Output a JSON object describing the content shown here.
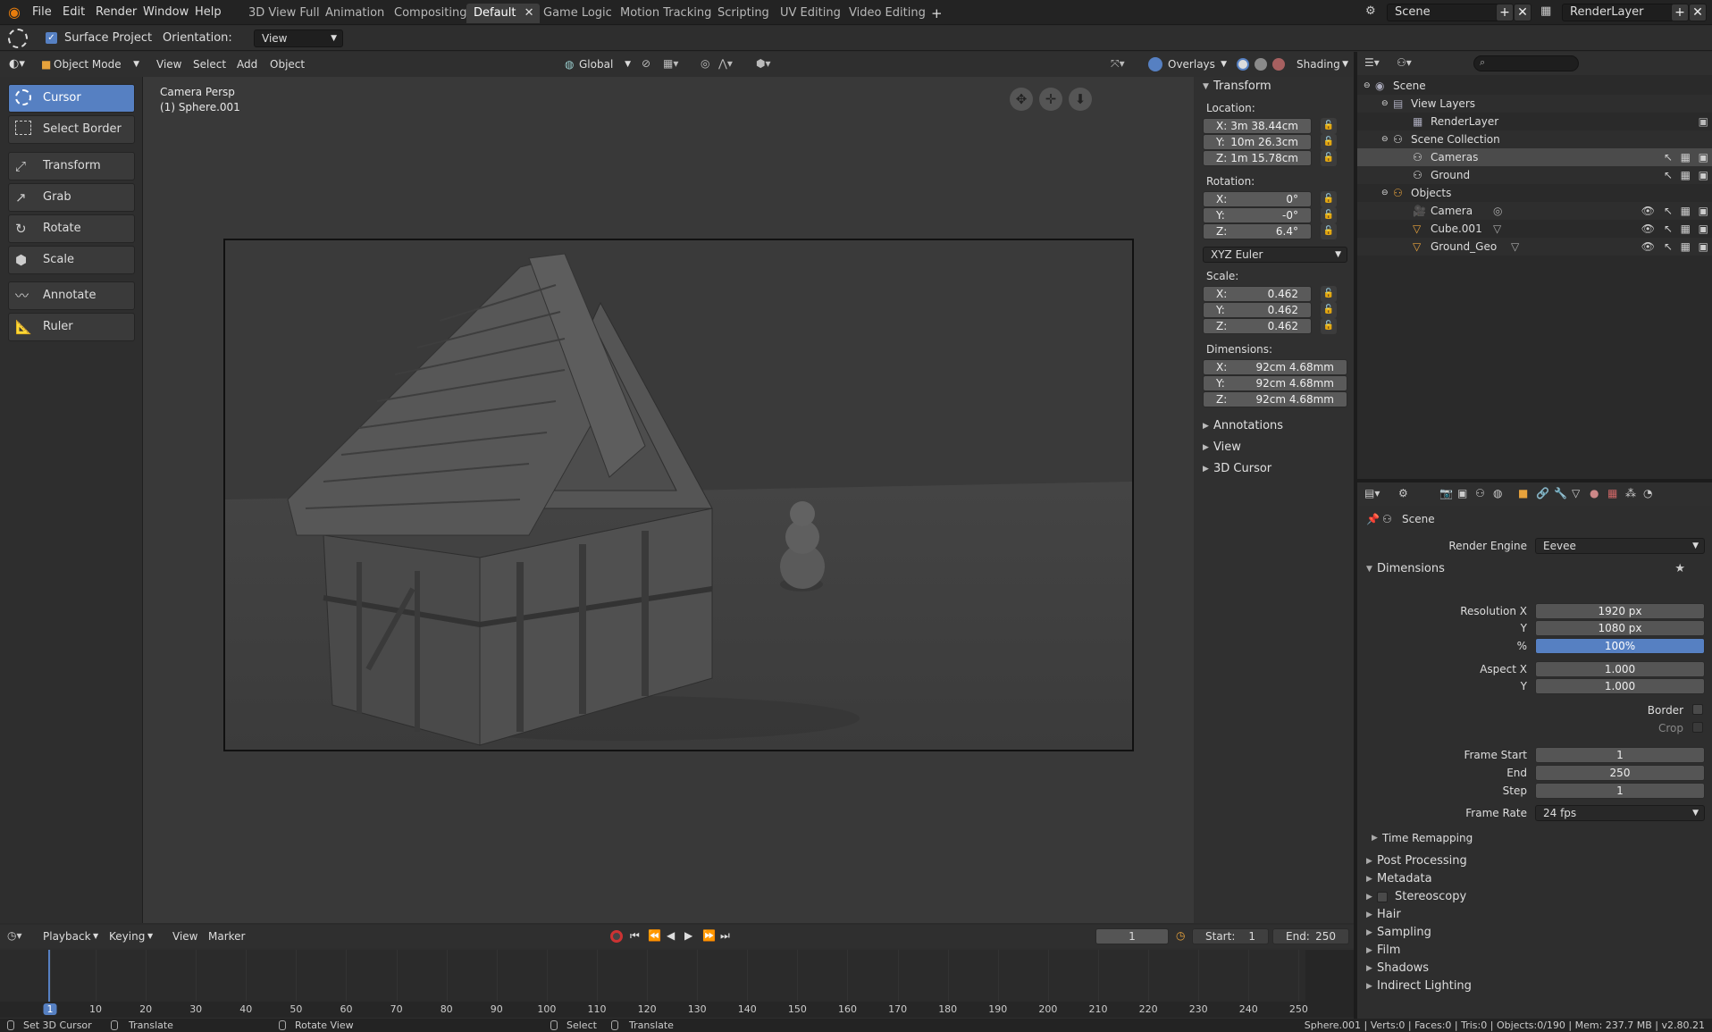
{
  "menu": [
    "File",
    "Edit",
    "Render",
    "Window",
    "Help"
  ],
  "workspaces": [
    {
      "label": "3D View Full",
      "active": false
    },
    {
      "label": "Animation",
      "active": false
    },
    {
      "label": "Compositing",
      "active": false
    },
    {
      "label": "Default",
      "active": true
    },
    {
      "label": "Game Logic",
      "active": false
    },
    {
      "label": "Motion Tracking",
      "active": false
    },
    {
      "label": "Scripting",
      "active": false
    },
    {
      "label": "UV Editing",
      "active": false
    },
    {
      "label": "Video Editing",
      "active": false
    }
  ],
  "scene_field": "Scene",
  "renderlayer_field": "RenderLayer",
  "tool_settings": {
    "surface_project": "Surface Project",
    "orientation_label": "Orientation:",
    "orientation_value": "View"
  },
  "view_header": {
    "mode": "Object Mode",
    "menus": [
      "View",
      "Select",
      "Add",
      "Object"
    ],
    "transform_orientation": "Global",
    "overlays": "Overlays",
    "shading": "Shading"
  },
  "viewport_info": {
    "line1": "Camera Persp",
    "line2": "(1) Sphere.001"
  },
  "tools": [
    {
      "label": "Cursor",
      "active": true,
      "icon": "cursor-icon"
    },
    {
      "label": "Select Border",
      "active": false,
      "icon": "select-border-icon"
    },
    {
      "label": "Transform",
      "active": false,
      "icon": "transform-icon"
    },
    {
      "label": "Grab",
      "active": false,
      "icon": "grab-icon"
    },
    {
      "label": "Rotate",
      "active": false,
      "icon": "rotate-icon"
    },
    {
      "label": "Scale",
      "active": false,
      "icon": "scale-icon"
    },
    {
      "label": "Annotate",
      "active": false,
      "icon": "annotate-icon"
    },
    {
      "label": "Ruler",
      "active": false,
      "icon": "ruler-icon"
    }
  ],
  "npanel": {
    "title": "Transform",
    "location_label": "Location:",
    "location": [
      {
        "a": "X:",
        "v": "3m 38.44cm"
      },
      {
        "a": "Y:",
        "v": "10m 26.3cm"
      },
      {
        "a": "Z:",
        "v": "1m 15.78cm"
      }
    ],
    "rotation_label": "Rotation:",
    "rotation": [
      {
        "a": "X:",
        "v": "0°"
      },
      {
        "a": "Y:",
        "v": "-0°"
      },
      {
        "a": "Z:",
        "v": "6.4°"
      }
    ],
    "rotation_mode": "XYZ Euler",
    "scale_label": "Scale:",
    "scale": [
      {
        "a": "X:",
        "v": "0.462"
      },
      {
        "a": "Y:",
        "v": "0.462"
      },
      {
        "a": "Z:",
        "v": "0.462"
      }
    ],
    "dimensions_label": "Dimensions:",
    "dimensions": [
      {
        "a": "X:",
        "v": "92cm 4.68mm"
      },
      {
        "a": "Y:",
        "v": "92cm 4.68mm"
      },
      {
        "a": "Z:",
        "v": "92cm 4.68mm"
      }
    ],
    "collapsed": [
      "Annotations",
      "View",
      "3D Cursor"
    ]
  },
  "outliner": [
    {
      "label": "Scene",
      "depth": 0
    },
    {
      "label": "View Layers",
      "depth": 1
    },
    {
      "label": "RenderLayer",
      "depth": 2
    },
    {
      "label": "Scene Collection",
      "depth": 1
    },
    {
      "label": "Cameras",
      "depth": 2,
      "selected": true
    },
    {
      "label": "Ground",
      "depth": 2
    },
    {
      "label": "Objects",
      "depth": 1
    },
    {
      "label": "Camera",
      "depth": 2
    },
    {
      "label": "Cube.001",
      "depth": 2
    },
    {
      "label": "Ground_Geo",
      "depth": 2
    }
  ],
  "properties": {
    "context": "Scene",
    "render_engine_label": "Render Engine",
    "render_engine": "Eevee",
    "dimensions_title": "Dimensions",
    "res_x_label": "Resolution X",
    "res_x": "1920 px",
    "res_y_label": "Y",
    "res_y": "1080 px",
    "res_pct_label": "%",
    "res_pct": "100%",
    "aspect_x_label": "Aspect X",
    "aspect_x": "1.000",
    "aspect_y_label": "Y",
    "aspect_y": "1.000",
    "border_label": "Border",
    "crop_label": "Crop",
    "frame_start_label": "Frame Start",
    "frame_start": "1",
    "end_label": "End",
    "end": "250",
    "step_label": "Step",
    "step": "1",
    "frame_rate_label": "Frame Rate",
    "frame_rate": "24 fps",
    "time_remapping": "Time Remapping",
    "sections": [
      "Post Processing",
      "Metadata",
      "Stereoscopy",
      "Hair",
      "Sampling",
      "Film",
      "Shadows",
      "Indirect Lighting"
    ]
  },
  "timeline": {
    "menus": [
      "Playback",
      "Keying",
      "View",
      "Marker"
    ],
    "current_frame": "1",
    "start_label": "Start:",
    "start": "1",
    "end_label": "End:",
    "end": "250",
    "ticks": [
      "1",
      "10",
      "20",
      "30",
      "40",
      "50",
      "60",
      "70",
      "80",
      "90",
      "100",
      "110",
      "120",
      "130",
      "140",
      "150",
      "160",
      "170",
      "180",
      "190",
      "200",
      "210",
      "220",
      "230",
      "240",
      "250"
    ]
  },
  "status": {
    "left": [
      "Set 3D Cursor",
      "Translate",
      "Rotate View",
      "Select",
      "Translate"
    ],
    "right": "Sphere.001 | Verts:0 | Faces:0 | Tris:0 | Objects:0/190 | Mem: 237.7 MB | v2.80.21"
  },
  "colors": {
    "accent": "#5680c2",
    "brand": "#e87d0d",
    "selected_row": "#4b4b4b"
  }
}
